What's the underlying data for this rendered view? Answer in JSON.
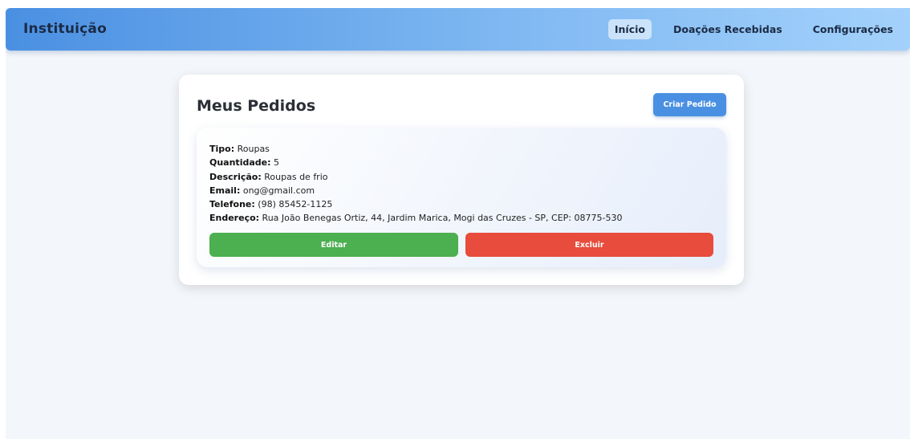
{
  "navbar": {
    "brand": "Instituição",
    "links": [
      {
        "label": "Início",
        "active": true
      },
      {
        "label": "Doações Recebidas",
        "active": false
      },
      {
        "label": "Configurações",
        "active": false
      }
    ]
  },
  "main": {
    "title": "Meus Pedidos",
    "create_button": "Criar Pedido",
    "orders": [
      {
        "fields": [
          {
            "label": "Tipo:",
            "value": "Roupas"
          },
          {
            "label": "Quantidade:",
            "value": "5"
          },
          {
            "label": "Descrição:",
            "value": "Roupas de frio"
          },
          {
            "label": "Email:",
            "value": "ong@gmail.com"
          },
          {
            "label": "Telefone:",
            "value": "(98) 85452-1125"
          },
          {
            "label": "Endereço:",
            "value": "Rua João Benegas Ortiz, 44, Jardim Marica, Mogi das Cruzes - SP, CEP: 08775-530"
          }
        ],
        "edit_button": "Editar",
        "delete_button": "Excluir"
      }
    ]
  },
  "colors": {
    "primary": "#4a90e2",
    "edit": "#4caf50",
    "delete": "#e74c3c",
    "background": "#f3f6fa"
  }
}
